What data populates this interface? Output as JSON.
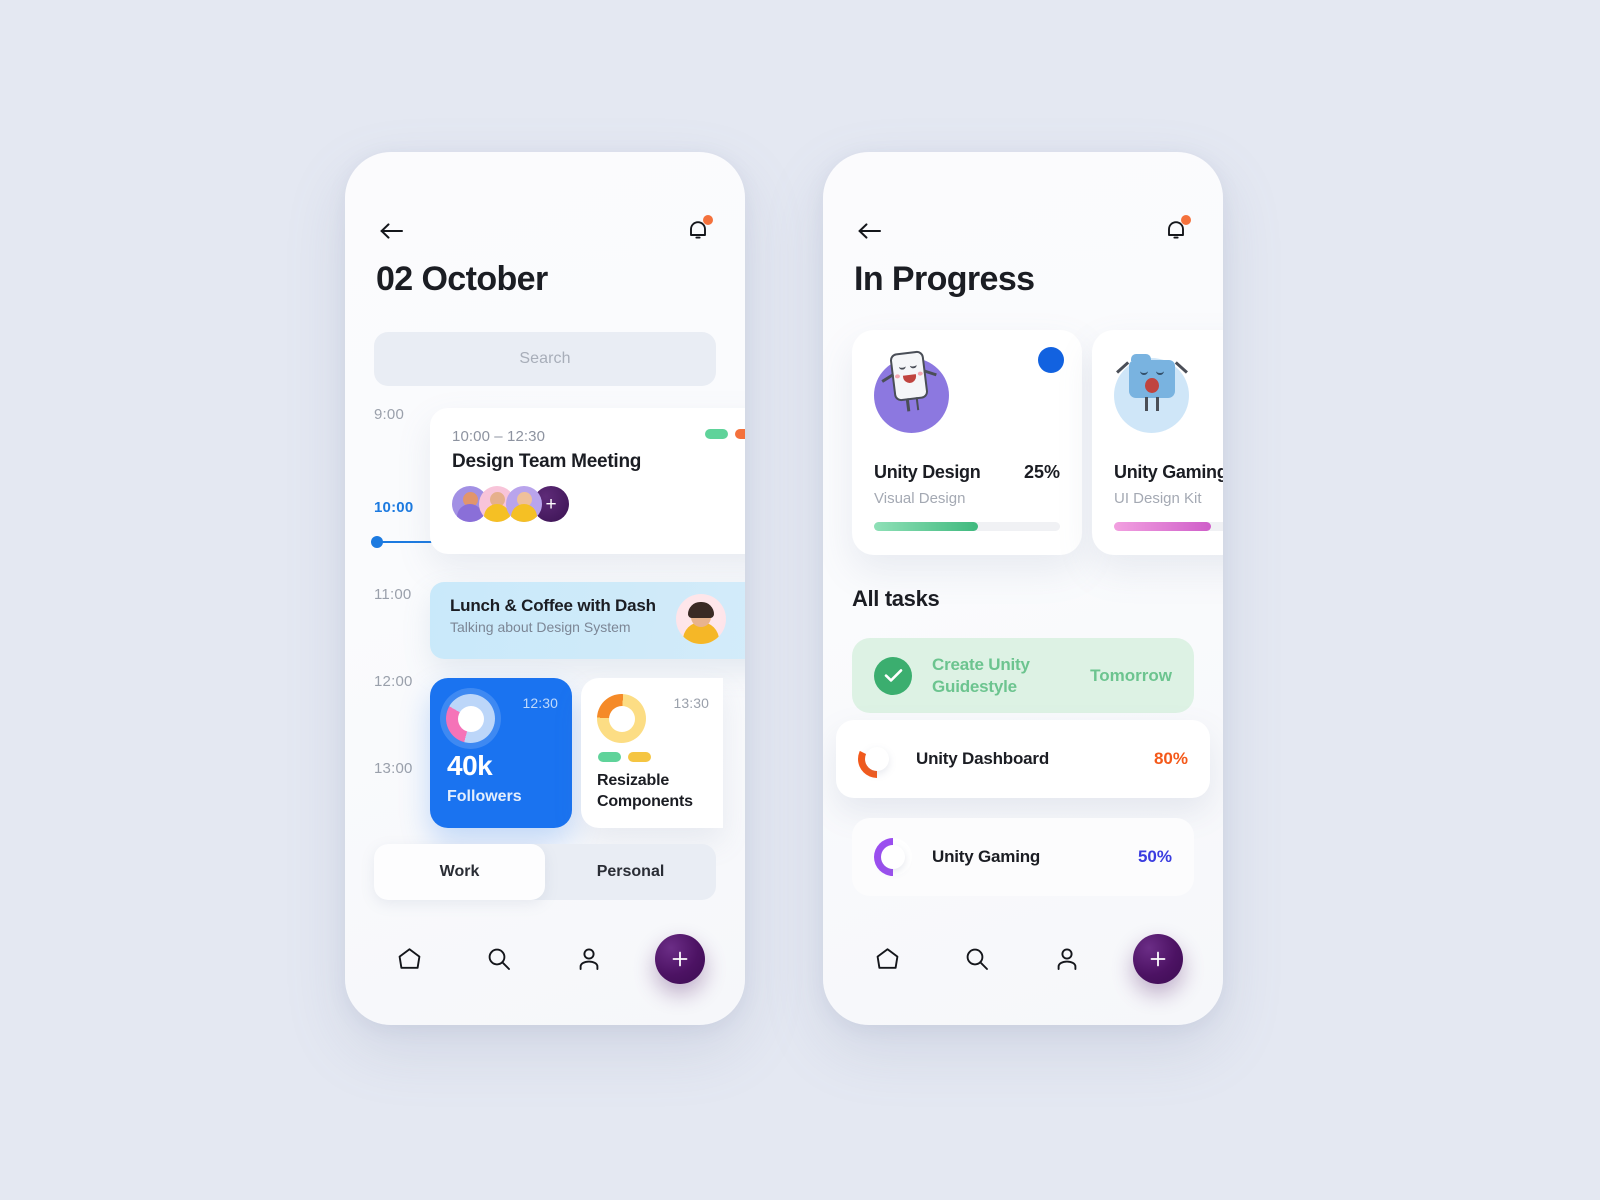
{
  "theme": {
    "background": "#e4e8f2",
    "accent_blue": "#1a73f0",
    "accent_purple": "#4c1263",
    "accent_green": "#3bae6f",
    "accent_orange": "#f4591a",
    "text_dark": "#1b1d23",
    "text_muted": "#9aa0ab"
  },
  "left_screen": {
    "topbar": {
      "back_icon": "arrow-left-icon",
      "bell_icon": "bell-icon",
      "bell_has_badge": true
    },
    "title": "02 October",
    "search": {
      "placeholder": "Search",
      "value": ""
    },
    "timeline": {
      "hours": [
        "9:00",
        "10:00",
        "11:00",
        "12:00",
        "13:00"
      ],
      "current_hour": "10:00",
      "events": [
        {
          "time": "10:00 – 12:30",
          "title": "Design Team Meeting",
          "tags": [
            "#5fd39a",
            "#f4713c"
          ],
          "attendees": [
            "avatar-1",
            "avatar-2",
            "avatar-3"
          ],
          "add_label": "+"
        },
        {
          "title": "Lunch & Coffee with Dash",
          "subtitle": "Talking about Design System",
          "avatar": "avatar-dash"
        }
      ],
      "stat_cards": [
        {
          "time": "12:30",
          "value": "40k",
          "label": "Followers",
          "donut": "donut-pink"
        },
        {
          "time": "13:30",
          "title": "Resizable Components",
          "tags": [
            "#5fd39a",
            "#f5c542"
          ],
          "donut": "donut-orange"
        }
      ]
    },
    "toggle": {
      "options": [
        "Work",
        "Personal"
      ],
      "selected": "Work"
    },
    "bottom_nav": {
      "items": [
        "home-icon",
        "search-icon",
        "profile-icon"
      ],
      "fab_label": "+"
    }
  },
  "right_screen": {
    "topbar": {
      "back_icon": "arrow-left-icon",
      "bell_icon": "bell-icon",
      "bell_has_badge": true
    },
    "title": "In Progress",
    "progress_cards": [
      {
        "title": "Unity Design",
        "percent": "25%",
        "subtitle": "Visual Design",
        "bar_color": "#4cc68c",
        "bar_width": "56%",
        "badge": true,
        "illustration": "phone-character-icon"
      },
      {
        "title": "Unity Gaming",
        "percent": "",
        "subtitle": "UI Design Kit",
        "bar_color": "#dd6fd6",
        "bar_width": "52%",
        "badge": false,
        "illustration": "folder-character-icon"
      }
    ],
    "section_title": "All tasks",
    "tasks": [
      {
        "name": "Create Unity Guidestyle",
        "meta": "Tomorrow",
        "state": "done",
        "icon": "check-icon"
      },
      {
        "name": "Unity Dashboard",
        "meta": "80%",
        "state": "active",
        "icon": "donut-80-icon"
      },
      {
        "name": "Unity Gaming",
        "meta": "50%",
        "state": "active",
        "icon": "donut-50-icon"
      }
    ],
    "bottom_nav": {
      "items": [
        "home-icon",
        "search-icon",
        "profile-icon"
      ],
      "fab_label": "+"
    }
  }
}
